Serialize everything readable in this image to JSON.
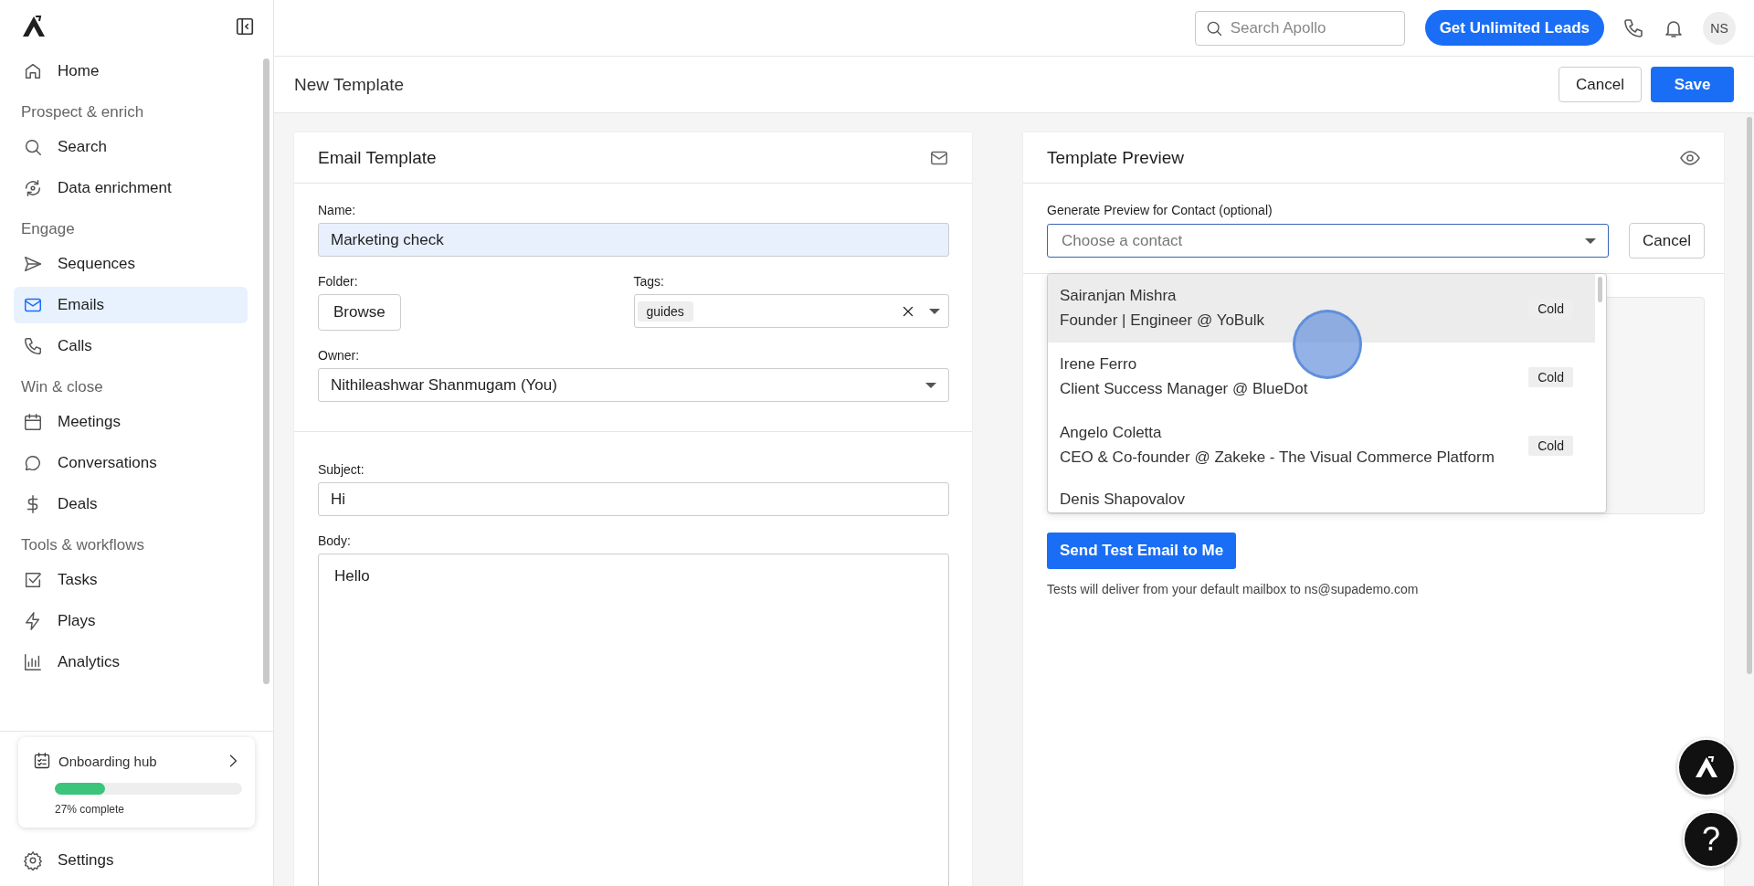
{
  "topbar": {
    "search": {
      "placeholder": "Search Apollo"
    },
    "upgrade_button": "Get Unlimited Leads",
    "avatar": "NS"
  },
  "sidebar": {
    "sections": [
      {
        "items": [
          {
            "label": "Home",
            "selected": false
          }
        ]
      },
      {
        "heading": "Prospect & enrich",
        "items": [
          {
            "label": "Search",
            "selected": false
          },
          {
            "label": "Data enrichment",
            "selected": false
          }
        ]
      },
      {
        "heading": "Engage",
        "items": [
          {
            "label": "Sequences",
            "selected": false
          },
          {
            "label": "Emails",
            "selected": true
          },
          {
            "label": "Calls",
            "selected": false
          }
        ]
      },
      {
        "heading": "Win & close",
        "items": [
          {
            "label": "Meetings",
            "selected": false
          },
          {
            "label": "Conversations",
            "selected": false
          },
          {
            "label": "Deals",
            "selected": false
          }
        ]
      },
      {
        "heading": "Tools & workflows",
        "items": [
          {
            "label": "Tasks",
            "selected": false
          },
          {
            "label": "Plays",
            "selected": false
          },
          {
            "label": "Analytics",
            "selected": false
          }
        ]
      }
    ],
    "onboarding": {
      "title": "Onboarding hub",
      "level": 0.27,
      "progress_text": "27% complete"
    },
    "settings": "Settings"
  },
  "header": {
    "title": "New Template",
    "cancel_button": "Cancel",
    "save_button": "Save"
  },
  "editor": {
    "title": "Email Template",
    "name_label": "Name:",
    "name_value": "Marketing check",
    "folder_label": "Folder:",
    "folder_button": "Browse",
    "tags_label": "Tags:",
    "tags": [
      "guides"
    ],
    "owner_label": "Owner:",
    "owner_value": "Nithileashwar Shanmugam (You)",
    "subject_label": "Subject:",
    "subject_value": "Hi",
    "body_label": "Body:",
    "body_value": "Hello"
  },
  "preview": {
    "title": "Template Preview",
    "contact_label": "Generate Preview for Contact (optional)",
    "contact_placeholder": "Choose a contact",
    "cancel_button": "Cancel",
    "contacts": [
      {
        "name": "Sairanjan Mishra",
        "title": "Founder | Engineer @ YoBulk",
        "tag": "Cold",
        "highlighted": true
      },
      {
        "name": "Irene Ferro",
        "title": "Client Success Manager @ BlueDot",
        "tag": "Cold",
        "highlighted": false
      },
      {
        "name": "Angelo Coletta",
        "title": "CEO & Co-founder @ Zakeke - The Visual Commerce Platform",
        "tag": "Cold",
        "highlighted": false
      },
      {
        "name": "Denis Shapovalov",
        "highlighted": false
      }
    ],
    "send_button": "Send Test Email to Me",
    "note": "Tests will deliver from your default mailbox to ns@supademo.com"
  },
  "help_button": "?"
}
